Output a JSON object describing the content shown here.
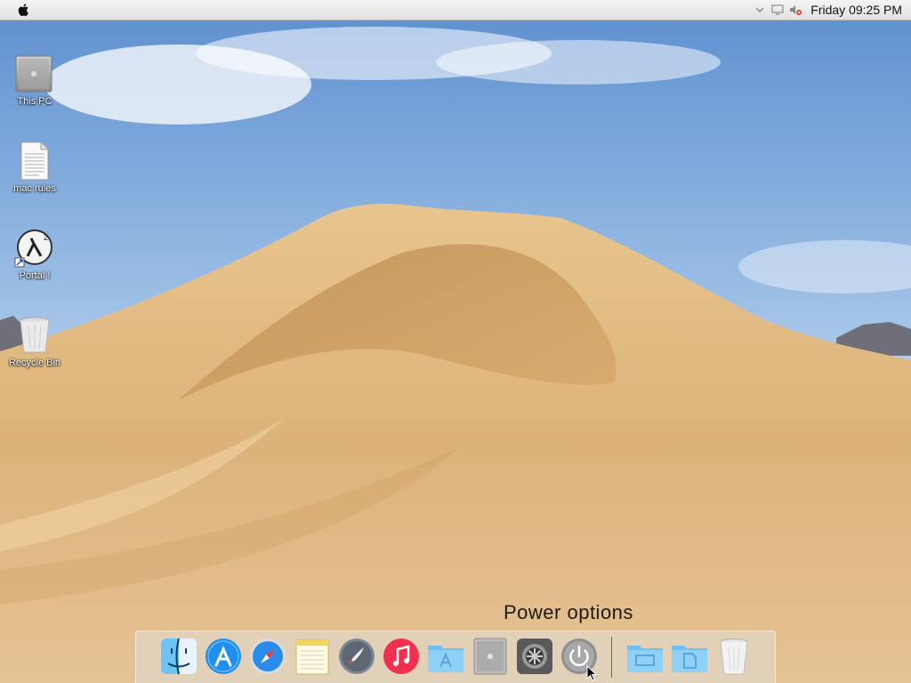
{
  "menubar": {
    "apple_icon": "apple-logo-icon",
    "tray_icons": [
      "chevron-down-icon",
      "monitor-icon",
      "volume-muted-icon"
    ],
    "clock": "Friday 09:25 PM"
  },
  "desktop": {
    "icons": [
      {
        "label": "This PC",
        "icon": "computer-icon"
      },
      {
        "label": "mac rules",
        "icon": "text-file-icon"
      },
      {
        "label": "Portal !",
        "icon": "half-life-shortcut-icon"
      },
      {
        "label": "Recycle Bin",
        "icon": "trash-icon"
      }
    ]
  },
  "dock": {
    "tooltip": "Power options",
    "items": [
      {
        "name": "finder",
        "icon": "finder-icon"
      },
      {
        "name": "app-store",
        "icon": "app-store-icon"
      },
      {
        "name": "safari",
        "icon": "safari-icon"
      },
      {
        "name": "notes",
        "icon": "notes-icon"
      },
      {
        "name": "launchpad",
        "icon": "rocket-icon"
      },
      {
        "name": "itunes",
        "icon": "music-icon"
      },
      {
        "name": "applications",
        "icon": "applications-folder-icon"
      },
      {
        "name": "this-pc",
        "icon": "computer-icon"
      },
      {
        "name": "system-preferences",
        "icon": "gear-icon"
      },
      {
        "name": "power-options",
        "icon": "power-icon"
      },
      {
        "name": "desktop-folder",
        "icon": "desktop-folder-icon"
      },
      {
        "name": "documents-folder",
        "icon": "documents-folder-icon"
      },
      {
        "name": "trash",
        "icon": "trash-icon"
      }
    ]
  },
  "colors": {
    "sky_top": "#6a9ad3",
    "sand": "#d9b27a",
    "dock_bg": "#e1d7c8"
  }
}
